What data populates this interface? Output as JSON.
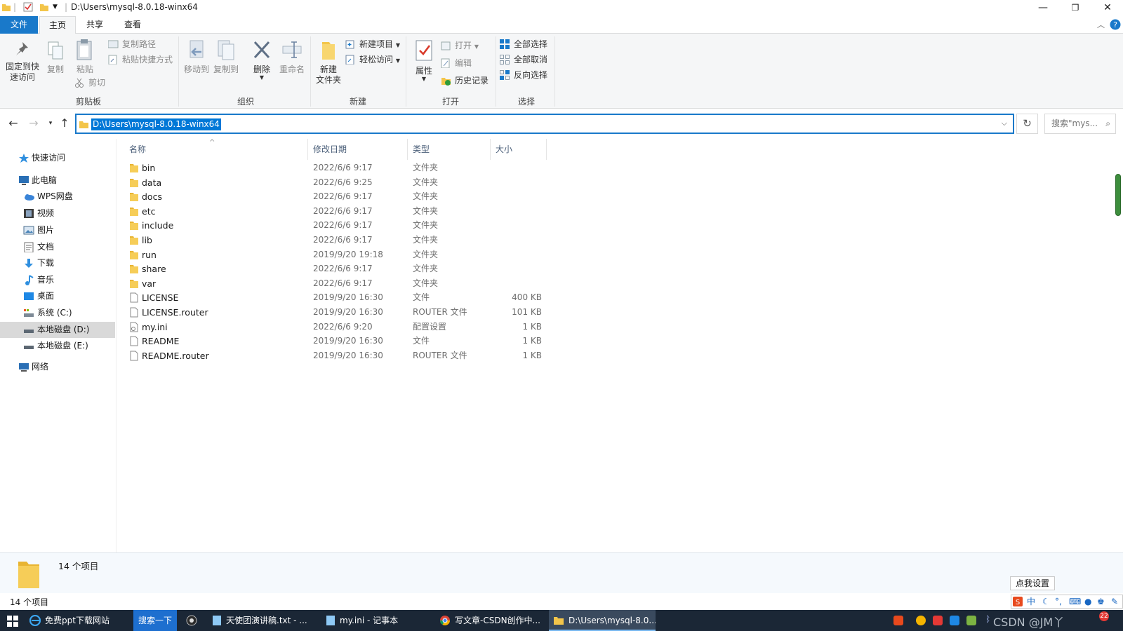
{
  "window": {
    "title": "D:\\Users\\mysql-8.0.18-winx64",
    "controls": {
      "minimize": "—",
      "restore": "❐",
      "close": "✕"
    }
  },
  "ribbon": {
    "tabs": {
      "file": "文件",
      "home": "主页",
      "share": "共享",
      "view": "查看"
    },
    "clipboard": {
      "group": "剪贴板",
      "pin_line1": "固定到快",
      "pin_line2": "速访问",
      "copy": "复制",
      "paste": "粘贴",
      "copy_path": "复制路径",
      "paste_shortcut": "粘贴快捷方式",
      "cut": "剪切"
    },
    "organize": {
      "group": "组织",
      "move_to": "移动到",
      "copy_to": "复制到",
      "delete": "删除",
      "rename": "重命名"
    },
    "new": {
      "group": "新建",
      "new_folder_line1": "新建",
      "new_folder_line2": "文件夹",
      "new_item": "新建项目",
      "easy_access": "轻松访问"
    },
    "open": {
      "group": "打开",
      "properties": "属性",
      "open": "打开",
      "edit": "编辑",
      "history": "历史记录"
    },
    "select": {
      "group": "选择",
      "select_all": "全部选择",
      "select_none": "全部取消",
      "invert": "反向选择"
    }
  },
  "address": {
    "path": "D:\\Users\\mysql-8.0.18-winx64",
    "search_placeholder": "搜索\"mys..."
  },
  "nav_pane": {
    "quick_access": "快速访问",
    "this_pc": "此电脑",
    "wps": "WPS网盘",
    "videos": "视频",
    "pictures": "图片",
    "documents": "文档",
    "downloads": "下载",
    "music": "音乐",
    "desktop": "桌面",
    "drive_c": "系统 (C:)",
    "drive_d": "本地磁盘 (D:)",
    "drive_e": "本地磁盘 (E:)",
    "network": "网络"
  },
  "columns": {
    "name": "名称",
    "date": "修改日期",
    "type": "类型",
    "size": "大小"
  },
  "files": [
    {
      "name": "bin",
      "date": "2022/6/6 9:17",
      "type": "文件夹",
      "size": "",
      "icon": "folder"
    },
    {
      "name": "data",
      "date": "2022/6/6 9:25",
      "type": "文件夹",
      "size": "",
      "icon": "folder"
    },
    {
      "name": "docs",
      "date": "2022/6/6 9:17",
      "type": "文件夹",
      "size": "",
      "icon": "folder"
    },
    {
      "name": "etc",
      "date": "2022/6/6 9:17",
      "type": "文件夹",
      "size": "",
      "icon": "folder"
    },
    {
      "name": "include",
      "date": "2022/6/6 9:17",
      "type": "文件夹",
      "size": "",
      "icon": "folder"
    },
    {
      "name": "lib",
      "date": "2022/6/6 9:17",
      "type": "文件夹",
      "size": "",
      "icon": "folder"
    },
    {
      "name": "run",
      "date": "2019/9/20 19:18",
      "type": "文件夹",
      "size": "",
      "icon": "folder"
    },
    {
      "name": "share",
      "date": "2022/6/6 9:17",
      "type": "文件夹",
      "size": "",
      "icon": "folder"
    },
    {
      "name": "var",
      "date": "2022/6/6 9:17",
      "type": "文件夹",
      "size": "",
      "icon": "folder"
    },
    {
      "name": "LICENSE",
      "date": "2019/9/20 16:30",
      "type": "文件",
      "size": "400 KB",
      "icon": "file"
    },
    {
      "name": "LICENSE.router",
      "date": "2019/9/20 16:30",
      "type": "ROUTER 文件",
      "size": "101 KB",
      "icon": "file"
    },
    {
      "name": "my.ini",
      "date": "2022/6/6 9:20",
      "type": "配置设置",
      "size": "1 KB",
      "icon": "settings-file"
    },
    {
      "name": "README",
      "date": "2019/9/20 16:30",
      "type": "文件",
      "size": "1 KB",
      "icon": "file"
    },
    {
      "name": "README.router",
      "date": "2019/9/20 16:30",
      "type": "ROUTER 文件",
      "size": "1 KB",
      "icon": "file"
    }
  ],
  "details": {
    "count": "14 个项目"
  },
  "status": {
    "count": "14 个项目"
  },
  "ime": {
    "tip": "点我设置",
    "mode": "中"
  },
  "taskbar": {
    "ie": "免费ppt下载网站",
    "search": "搜索一下",
    "notepad1": "天使团演讲稿.txt - ...",
    "notepad2": "my.ini - 记事本",
    "chrome": "写文章-CSDN创作中...",
    "explorer": "D:\\Users\\mysql-8.0...",
    "watermark": "CSDN @JM丫",
    "badge": "22"
  },
  "colors": {
    "accent": "#1979ca",
    "folder": "#f3c54a",
    "taskbar": "#1b2736"
  }
}
